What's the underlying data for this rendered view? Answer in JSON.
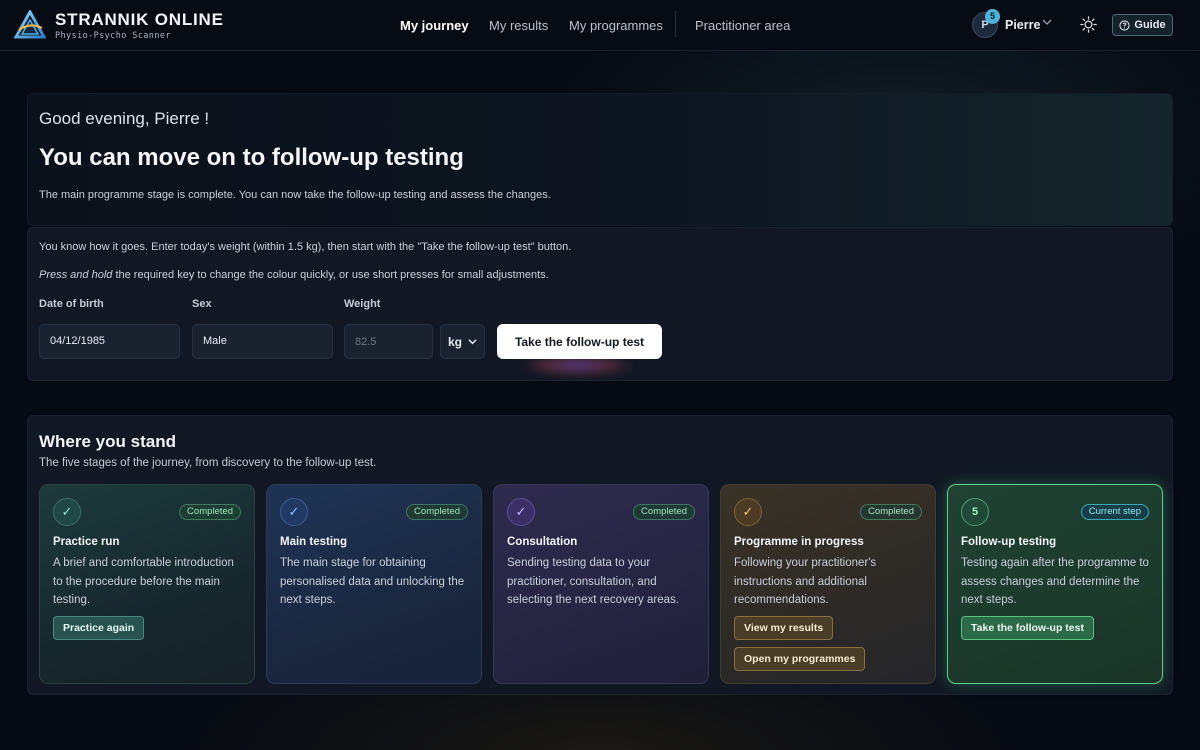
{
  "brand": {
    "name": "STRANNIK ONLINE",
    "tagline": "Physio-Psycho Scanner"
  },
  "nav": {
    "items": [
      {
        "label": "My journey",
        "active": true
      },
      {
        "label": "My results",
        "active": false
      },
      {
        "label": "My programmes",
        "active": false
      },
      {
        "label": "Practitioner area",
        "active": false
      }
    ]
  },
  "user": {
    "initial": "P",
    "notification_count": "5",
    "name": "Pierre"
  },
  "header_actions": {
    "guide_label": "Guide"
  },
  "hero": {
    "greeting": "Good evening, Pierre !",
    "title": "You can move on to follow-up testing",
    "description": "The main programme stage is complete. You can now take the follow-up testing and assess the changes."
  },
  "form": {
    "instruction_1": "You know how it goes. Enter today's weight (within 1.5 kg), then start with the \"Take the follow-up test\" button.",
    "instruction_2_em": "Press and hold",
    "instruction_2_rest": " the required key to change the colour quickly, or use short presses for small adjustments.",
    "dob_label": "Date of birth",
    "dob_value": "04/12/1985",
    "sex_label": "Sex",
    "sex_value": "Male",
    "weight_label": "Weight",
    "weight_placeholder": "82.5",
    "unit_value": "kg",
    "submit_label": "Take the follow-up test"
  },
  "journey": {
    "title": "Where you stand",
    "subtitle": "The five stages of the journey, from discovery to the follow-up test.",
    "steps": [
      {
        "icon": "✓",
        "badge": "Completed",
        "title": "Practice run",
        "description": "A brief and comfortable introduction to the procedure before the main testing.",
        "buttons": [
          "Practice again"
        ]
      },
      {
        "icon": "✓",
        "badge": "Completed",
        "title": "Main testing",
        "description": "The main stage for obtaining personalised data and unlocking the next steps.",
        "buttons": []
      },
      {
        "icon": "✓",
        "badge": "Completed",
        "title": "Consultation",
        "description": "Sending testing data to your practitioner, consultation, and selecting the next recovery areas.",
        "buttons": []
      },
      {
        "icon": "✓",
        "badge": "Completed",
        "title": "Programme in progress",
        "description": "Following your practitioner's instructions and additional recommendations.",
        "buttons": [
          "View my results",
          "Open my programmes"
        ]
      },
      {
        "icon": "5",
        "badge": "Current step",
        "title": "Follow-up testing",
        "description": "Testing again after the programme to assess changes and determine the next steps.",
        "buttons": [
          "Take the follow-up test"
        ]
      }
    ]
  }
}
